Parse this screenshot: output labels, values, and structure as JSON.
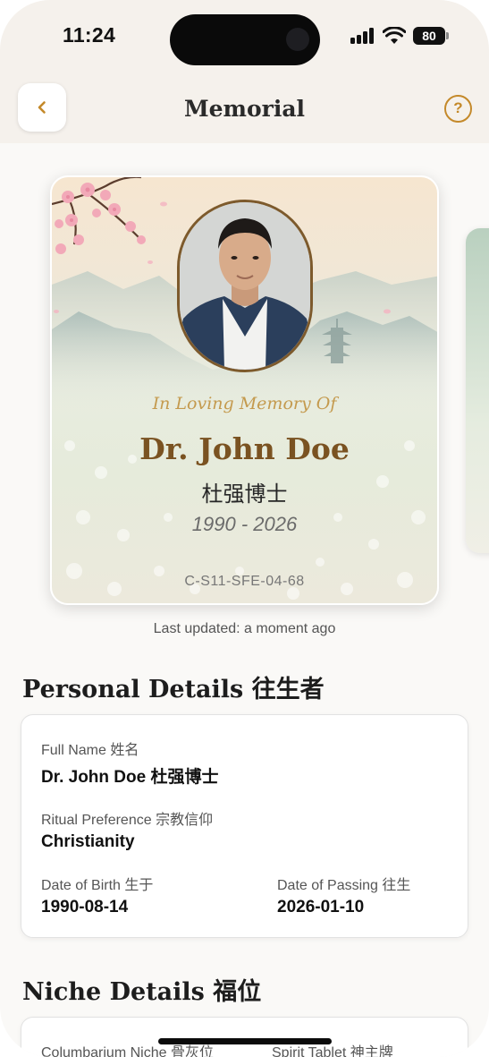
{
  "status_bar": {
    "time": "11:24",
    "battery": "80"
  },
  "header": {
    "title": "Memorial",
    "help_label": "?"
  },
  "memorial_card": {
    "in_loving_memory": "In Loving Memory Of",
    "name_en": "Dr. John Doe",
    "name_cn": "杜强博士",
    "years": "1990 - 2026",
    "niche_code": "C-S11-SFE-04-68"
  },
  "last_updated": "Last updated: a moment ago",
  "personal_details": {
    "title": "Personal Details 往生者",
    "full_name_label": "Full Name 姓名",
    "full_name_value": "Dr. John Doe 杜强博士",
    "ritual_label": "Ritual Preference 宗教信仰",
    "ritual_value": "Christianity",
    "dob_label": "Date of Birth 生于",
    "dob_value": "1990-08-14",
    "dop_label": "Date of Passing 往生",
    "dop_value": "2026-01-10"
  },
  "niche_details": {
    "title": "Niche Details 福位",
    "columbarium_label": "Columbarium Niche 骨灰位",
    "spirit_tablet_label": "Spirit Tablet 神主牌"
  },
  "icons": {
    "back": "chevron-left-icon",
    "help": "question-circle-icon"
  },
  "colors": {
    "accent_gold": "#c4892a",
    "name_brown": "#7a5221",
    "header_bg": "#f5f1ec"
  }
}
